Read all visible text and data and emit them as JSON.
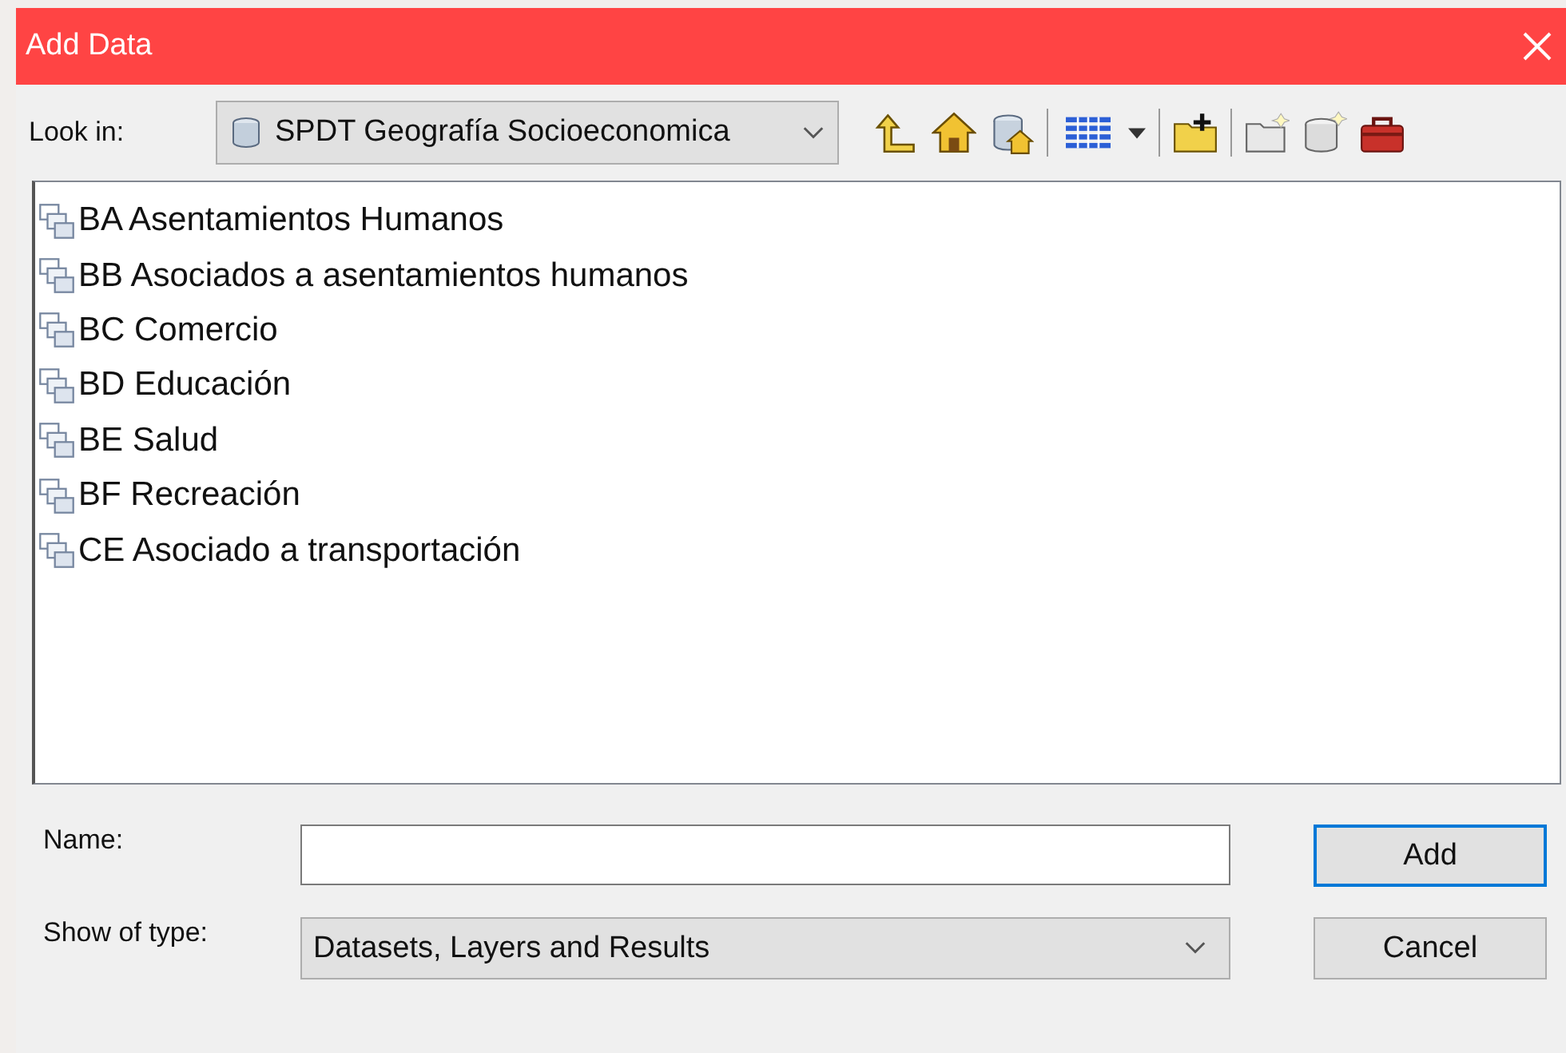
{
  "window": {
    "title": "Add Data"
  },
  "look_in": {
    "label": "Look in:",
    "value": "SPDT Geografía Socioeconomica"
  },
  "items": [
    {
      "label": "BA Asentamientos Humanos"
    },
    {
      "label": "BB Asociados a asentamientos humanos"
    },
    {
      "label": "BC Comercio"
    },
    {
      "label": "BD Educación"
    },
    {
      "label": "BE Salud"
    },
    {
      "label": "BF Recreación"
    },
    {
      "label": "CE Asociado a transportación"
    }
  ],
  "name": {
    "label": "Name:"
  },
  "show_of_type": {
    "label": "Show of type:",
    "value": "Datasets, Layers and Results"
  },
  "buttons": [
    {
      "label": "Add",
      "default": true
    },
    {
      "label": "Cancel",
      "default": false
    }
  ]
}
